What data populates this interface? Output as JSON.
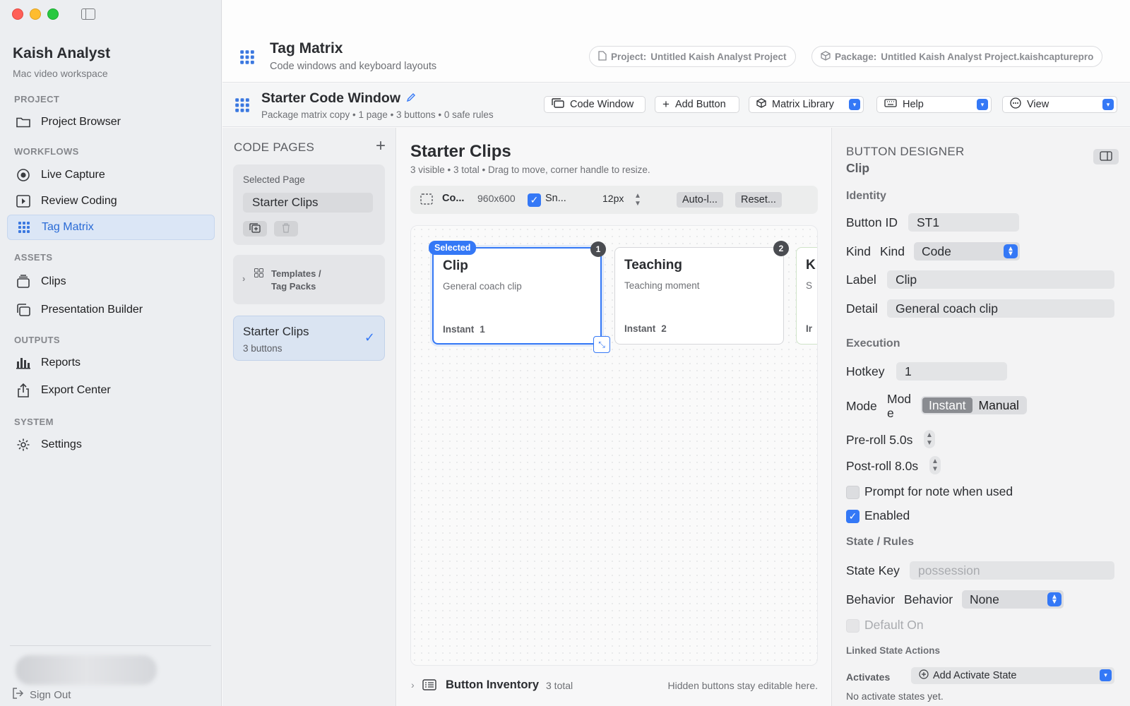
{
  "sidebar": {
    "app_title": "Kaish Analyst",
    "app_subtitle": "Mac video workspace",
    "sections": {
      "project": "PROJECT",
      "workflows": "WORKFLOWS",
      "assets": "ASSETS",
      "outputs": "OUTPUTS",
      "system": "SYSTEM"
    },
    "items": {
      "project_browser": "Project Browser",
      "live_capture": "Live Capture",
      "review_coding": "Review Coding",
      "tag_matrix": "Tag Matrix",
      "clips": "Clips",
      "presentation_builder": "Presentation Builder",
      "reports": "Reports",
      "export_center": "Export Center",
      "settings": "Settings"
    },
    "sign_out": "Sign Out",
    "accent_color": "#2a6bd6"
  },
  "header": {
    "title": "Tag Matrix",
    "subtitle": "Code windows and keyboard layouts",
    "project_label": "Project:",
    "project_value": "Untitled Kaish Analyst Project",
    "package_label": "Package:",
    "package_value": "Untitled Kaish Analyst Project.kaishcapturepro"
  },
  "toolbar": {
    "window_title": "Starter Code Window",
    "window_subtitle": "Package matrix copy • 1 page • 3 buttons • 0 safe rules",
    "code_window": "Code Window",
    "add_button": "Add Button",
    "matrix_library": "Matrix Library",
    "help": "Help",
    "view": "View"
  },
  "pages": {
    "header": "CODE PAGES",
    "selected_page_label": "Selected Page",
    "selected_page_value": "Starter Clips",
    "templates_line1": "Templates /",
    "templates_line2": "Tag Packs",
    "page_item_title": "Starter Clips",
    "page_item_sub": "3 buttons"
  },
  "canvas": {
    "title": "Starter Clips",
    "subtitle": "3 visible • 3 total • Drag to move, corner handle to resize.",
    "tool_co": "Co...",
    "tool_size": "960x600",
    "tool_snap": "Sn...",
    "tool_grid": "12px",
    "tool_auto": "Auto-l...",
    "tool_reset": "Reset...",
    "selected_tag": "Selected",
    "cards": [
      {
        "title": "Clip",
        "detail": "General coach clip",
        "mode": "Instant",
        "hotkey": "1",
        "badge": "1"
      },
      {
        "title": "Teaching",
        "detail": "Teaching moment",
        "mode": "Instant",
        "hotkey": "2",
        "badge": "2"
      },
      {
        "title": "K",
        "detail": "S",
        "mode": "Ir"
      }
    ],
    "inventory_title": "Button Inventory",
    "inventory_count": "3 total",
    "inventory_hint": "Hidden buttons stay editable here."
  },
  "designer": {
    "header": "BUTTON DESIGNER",
    "subheader": "Clip",
    "identity": "Identity",
    "button_id_label": "Button ID",
    "button_id_value": "ST1",
    "kind_label": "Kind",
    "kind_inner": "Kind",
    "kind_value": "Code",
    "label_label": "Label",
    "label_value": "Clip",
    "detail_label": "Detail",
    "detail_value": "General coach clip",
    "execution": "Execution",
    "hotkey_label": "Hotkey",
    "hotkey_value": "1",
    "mode_label": "Mode",
    "mode_inner_1": "Mod",
    "mode_inner_2": "e",
    "mode_instant": "Instant",
    "mode_manual": "Manual",
    "preroll": "Pre-roll 5.0s",
    "postroll": "Post-roll 8.0s",
    "prompt_note": "Prompt for note when used",
    "enabled": "Enabled",
    "state_rules": "State / Rules",
    "state_key_label": "State Key",
    "state_key_placeholder": "possession",
    "behavior_label": "Behavior",
    "behavior_inner": "Behavior",
    "behavior_value": "None",
    "default_on": "Default On",
    "linked_actions": "Linked State Actions",
    "activates_label": "Activates",
    "add_activate": "Add Activate State",
    "no_activate": "No activate states yet."
  }
}
